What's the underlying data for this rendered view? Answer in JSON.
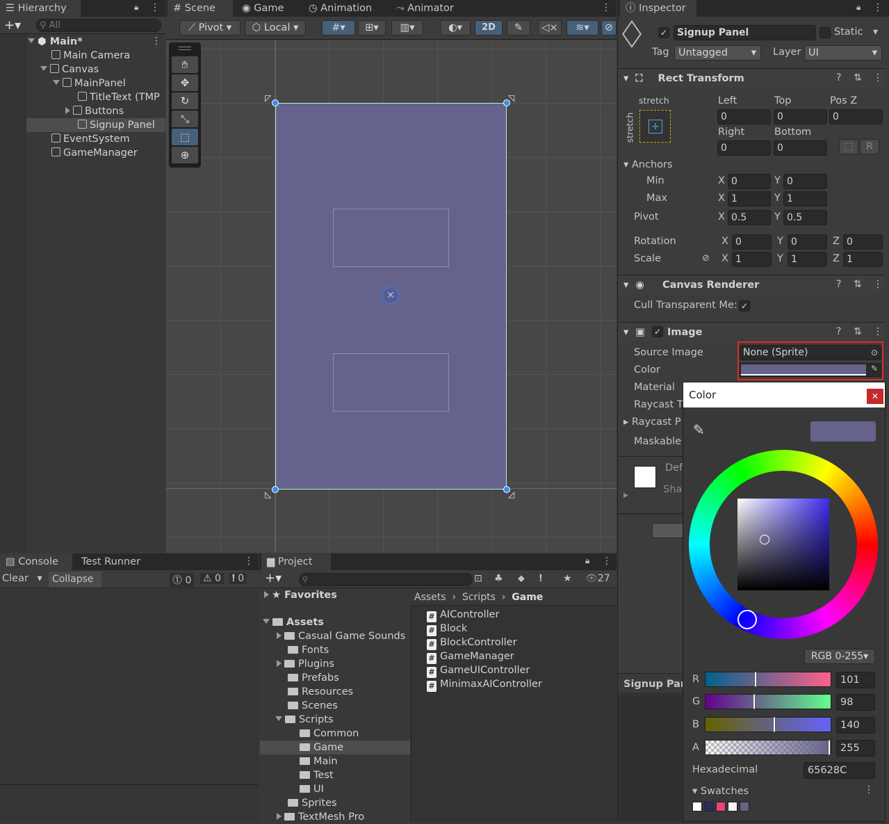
{
  "hierarchy": {
    "tab": "Hierarchy",
    "search_placeholder": "All",
    "items": [
      {
        "label": "Main*"
      },
      {
        "label": "Main Camera"
      },
      {
        "label": "Canvas"
      },
      {
        "label": "MainPanel"
      },
      {
        "label": "TitleText (TMP"
      },
      {
        "label": "Buttons"
      },
      {
        "label": "Signup Panel"
      },
      {
        "label": "EventSystem"
      },
      {
        "label": "GameManager"
      }
    ]
  },
  "scene": {
    "tabs": [
      "Scene",
      "Game",
      "Animation",
      "Animator"
    ],
    "toolbar": {
      "pivot": "Pivot",
      "local": "Local",
      "mode_2d": "2D"
    },
    "panel_color": "#65628C"
  },
  "inspector": {
    "tab": "Inspector",
    "object_name": "Signup Panel",
    "static_label": "Static",
    "tag_label": "Tag",
    "tag_value": "Untagged",
    "layer_label": "Layer",
    "layer_value": "UI",
    "rect_transform": {
      "title": "Rect Transform",
      "stretch_top": "stretch",
      "stretch_side": "stretch",
      "left_label": "Left",
      "left": "0",
      "top_label": "Top",
      "top": "0",
      "posz_label": "Pos Z",
      "posz": "0",
      "right_label": "Right",
      "right": "0",
      "bottom_label": "Bottom",
      "bottom": "0",
      "r_button": "R",
      "anchors_label": "Anchors",
      "min_label": "Min",
      "min_x": "0",
      "min_y": "0",
      "max_label": "Max",
      "max_x": "1",
      "max_y": "1",
      "pivot_label": "Pivot",
      "pivot_x": "0.5",
      "pivot_y": "0.5",
      "rotation_label": "Rotation",
      "rot_x": "0",
      "rot_y": "0",
      "rot_z": "0",
      "scale_label": "Scale",
      "scale_x": "1",
      "scale_y": "1",
      "scale_z": "1",
      "x": "X",
      "y": "Y",
      "z": "Z"
    },
    "canvas_renderer": {
      "title": "Canvas Renderer",
      "cull_label": "Cull Transparent Me:"
    },
    "image": {
      "title": "Image",
      "source_label": "Source Image",
      "source_value": "None (Sprite)",
      "color_label": "Color",
      "material_label": "Material",
      "raycast_target_label": "Raycast T",
      "raycast_padding_label": "Raycast P",
      "maskable_label": "Maskable",
      "def_label": "Def",
      "sha_label": "Sha"
    },
    "footer_label": "Signup Pan"
  },
  "color_picker": {
    "title": "Color",
    "mode": "RGB 0-255",
    "r_label": "R",
    "r": "101",
    "g_label": "G",
    "g": "98",
    "b_label": "B",
    "b": "140",
    "a_label": "A",
    "a": "255",
    "r_level": 0.396,
    "g_level": 0.384,
    "b_level": 0.549,
    "a_level": 1.0,
    "hex_label": "Hexadecimal",
    "hex": "65628C",
    "swatches_label": "Swatches",
    "swatch_colors": [
      "#ffffff",
      "#2a2d5a",
      "#e8437a",
      "#f4f4f4",
      "#65628C"
    ]
  },
  "console": {
    "tabs": [
      "Console",
      "Test Runner"
    ],
    "clear": "Clear",
    "collapse": "Collapse",
    "errors": "0",
    "warnings": "0",
    "messages": "0"
  },
  "project": {
    "tab": "Project",
    "hidden_count": "27",
    "favorites": "Favorites",
    "assets": "Assets",
    "tree": [
      {
        "label": "Casual Game Sounds"
      },
      {
        "label": "Fonts"
      },
      {
        "label": "Plugins"
      },
      {
        "label": "Prefabs"
      },
      {
        "label": "Resources"
      },
      {
        "label": "Scenes"
      },
      {
        "label": "Scripts"
      },
      {
        "label": "Common"
      },
      {
        "label": "Game"
      },
      {
        "label": "Main"
      },
      {
        "label": "Test"
      },
      {
        "label": "UI"
      },
      {
        "label": "Sprites"
      },
      {
        "label": "TextMesh Pro"
      }
    ],
    "breadcrumb": [
      "Assets",
      "Scripts",
      "Game"
    ],
    "files": [
      "AIController",
      "Block",
      "BlockController",
      "GameManager",
      "GameUIController",
      "MinimaxAIController"
    ]
  }
}
